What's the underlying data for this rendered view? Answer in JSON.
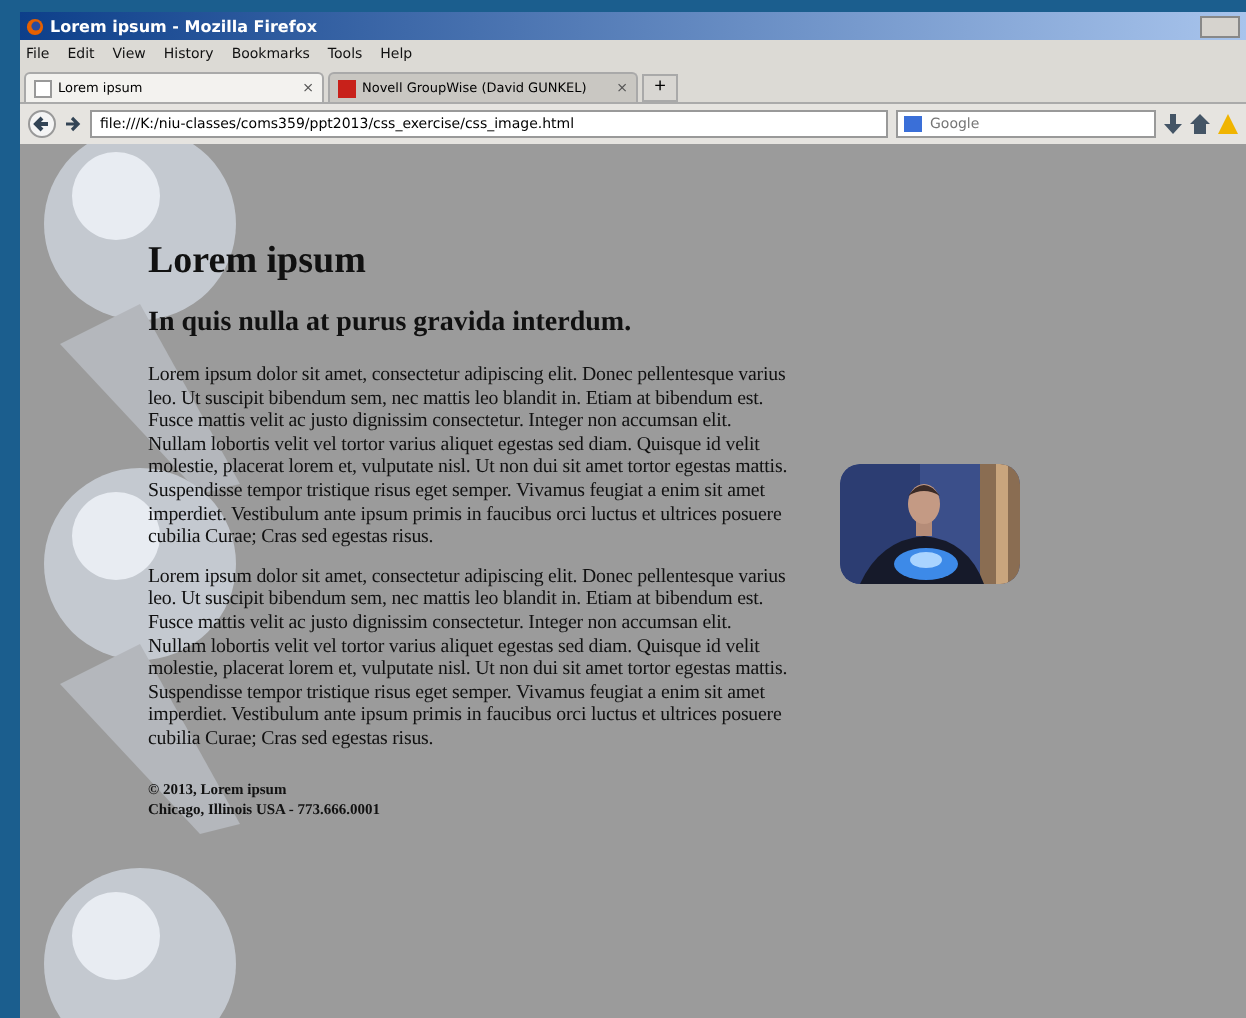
{
  "window": {
    "title": "Lorem ipsum - Mozilla Firefox"
  },
  "menu": [
    "File",
    "Edit",
    "View",
    "History",
    "Bookmarks",
    "Tools",
    "Help"
  ],
  "tabs": [
    {
      "label": "Lorem ipsum",
      "selected": true,
      "close": "×"
    },
    {
      "label": "Novell GroupWise (David GUNKEL)",
      "selected": false,
      "close": "×"
    }
  ],
  "new_tab": "+",
  "address_bar": {
    "value": "file:///K:/niu-classes/coms359/ppt2013/css_exercise/css_image.html"
  },
  "search": {
    "placeholder": "Google"
  },
  "page": {
    "heading": "Lorem ipsum",
    "subheading": "In quis nulla at purus gravida interdum.",
    "paragraphs": [
      "Lorem ipsum dolor sit amet, consectetur adipiscing elit. Donec pellentesque varius leo. Ut suscipit bibendum sem, nec mattis leo blandit in. Etiam at bibendum est. Fusce mattis velit ac justo dignissim consectetur. Integer non accumsan elit. Nullam lobortis velit vel tortor varius aliquet egestas sed diam. Quisque id velit molestie, placerat lorem et, vulputate nisl. Ut non dui sit amet tortor egestas mattis. Suspendisse tempor tristique risus eget semper. Vivamus feugiat a enim sit amet imperdiet. Vestibulum ante ipsum primis in faucibus orci luctus et ultrices posuere cubilia Curae; Cras sed egestas risus.",
      "Lorem ipsum dolor sit amet, consectetur adipiscing elit. Donec pellentesque varius leo. Ut suscipit bibendum sem, nec mattis leo blandit in. Etiam at bibendum est. Fusce mattis velit ac justo dignissim consectetur. Integer non accumsan elit. Nullam lobortis velit vel tortor varius aliquet egestas sed diam. Quisque id velit molestie, placerat lorem et, vulputate nisl. Ut non dui sit amet tortor egestas mattis. Suspendisse tempor tristique risus eget semper. Vivamus feugiat a enim sit amet imperdiet. Vestibulum ante ipsum primis in faucibus orci luctus et ultrices posuere cubilia Curae; Cras sed egestas risus."
    ],
    "footer": [
      "© 2013, Lorem ipsum",
      "Chicago, Illinois USA - 773.666.0001"
    ]
  }
}
